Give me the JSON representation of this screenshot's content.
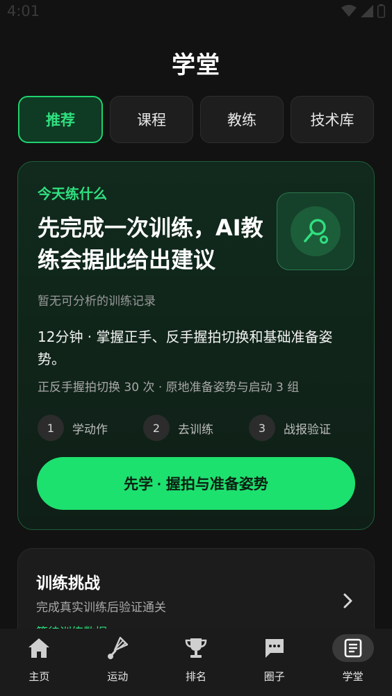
{
  "status": {
    "time": "4:01"
  },
  "page": {
    "title": "学堂"
  },
  "tabs": [
    {
      "label": "推荐",
      "active": true
    },
    {
      "label": "课程",
      "active": false
    },
    {
      "label": "教练",
      "active": false
    },
    {
      "label": "技术库",
      "active": false
    }
  ],
  "hero": {
    "kicker": "今天练什么",
    "heading": "先完成一次训练，AI教练会据此给出建议",
    "empty_note": "暂无可分析的训练记录",
    "plan": "12分钟 · 掌握正手、反手握拍切换和基础准备姿势。",
    "detail": "正反手握拍切换 30 次 · 原地准备姿势与启动 3 组",
    "steps": [
      {
        "num": "1",
        "label": "学动作"
      },
      {
        "num": "2",
        "label": "去训练"
      },
      {
        "num": "3",
        "label": "战报验证"
      }
    ],
    "cta": "先学 · 握拍与准备姿势",
    "icon": "racket-icon"
  },
  "challenge": {
    "title": "训练挑战",
    "subtitle": "完成真实训练后验证通关",
    "link": "等待训练数据"
  },
  "nav": [
    {
      "label": "主页",
      "icon": "home-icon",
      "active": false
    },
    {
      "label": "运动",
      "icon": "shuttlecock-icon",
      "active": false
    },
    {
      "label": "排名",
      "icon": "trophy-icon",
      "active": false
    },
    {
      "label": "圈子",
      "icon": "chat-icon",
      "active": false
    },
    {
      "label": "学堂",
      "icon": "book-icon",
      "active": true
    }
  ],
  "colors": {
    "accent": "#1de16e",
    "background": "#121212"
  }
}
